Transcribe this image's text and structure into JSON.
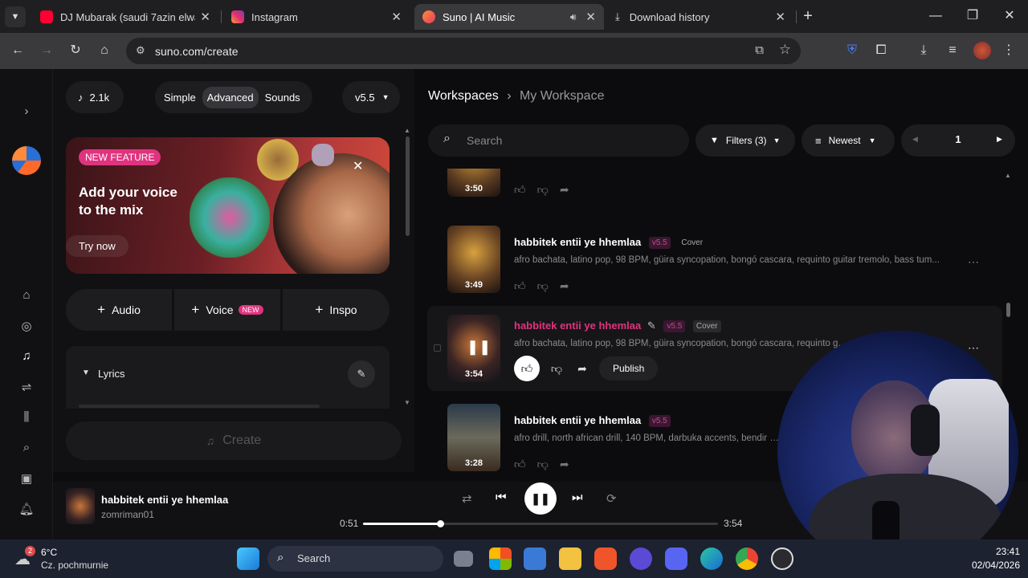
{
  "browser": {
    "tabs": [
      {
        "label": "DJ Mubarak (saudi 7azin elwat)",
        "color": "#ff0033",
        "active": false
      },
      {
        "label": "Instagram",
        "color": "#e1306c",
        "active": false
      },
      {
        "label": "Suno | AI Music",
        "color": "#ff6a3d",
        "active": true
      },
      {
        "label": "Download history",
        "color": "#cccccc",
        "active": false
      }
    ],
    "url": "suno.com/create"
  },
  "create": {
    "credits": "2.1k",
    "modes": [
      "Simple",
      "Advanced",
      "Sounds"
    ],
    "active_mode": "Advanced",
    "version": "v5.5",
    "banner": {
      "badge": "NEW FEATURE",
      "title_line1": "Add your voice",
      "title_line2": "to the mix",
      "cta": "Try now"
    },
    "tools": {
      "audio": "Audio",
      "voice": "Voice",
      "voice_badge": "NEW",
      "inspo": "Inspo"
    },
    "lyrics_label": "Lyrics",
    "create_button": "Create"
  },
  "workspace": {
    "breadcrumb_root": "Workspaces",
    "breadcrumb_current": "My Workspace",
    "search_placeholder": "Search",
    "filters_label": "Filters (3)",
    "sort_label": "Newest",
    "page": "1",
    "songs": [
      {
        "title": "",
        "tags": "",
        "duration": "3:50",
        "version": "",
        "type": ""
      },
      {
        "title": "habbitek entii ye hhemlaa",
        "tags": "afro bachata, latino pop, 98 BPM, güira syncopation, bongó cascara, requinto guitar tremolo, bass tum...",
        "duration": "3:49",
        "version": "v5.5",
        "type": "Cover"
      },
      {
        "title": "habbitek entii ye hhemlaa",
        "tags": "afro bachata, latino pop, 98 BPM, güira syncopation, bongó cascara, requinto guitar tr...",
        "duration": "3:54",
        "version": "v5.5",
        "type": "Cover",
        "publish": "Publish"
      },
      {
        "title": "habbitek entii ye hhemlaa",
        "tags": "afro drill, north african drill, 140 BPM, darbuka accents, bendir strik...",
        "duration": "3:28",
        "version": "v5.5",
        "type": ""
      }
    ]
  },
  "player": {
    "title": "habbitek entii ye hhemlaa",
    "artist": "zomriman01",
    "elapsed": "0:51",
    "total": "3:54",
    "progress": 0.2179
  },
  "taskbar": {
    "temperature": "6°C",
    "weather": "Cz. pochmurnie",
    "weather_badge": "2",
    "search": "Search",
    "time": "23:41",
    "date": "02/04/2026"
  },
  "colors": {
    "accent_pink": "#e0337f",
    "version_badge": "#c04a8e"
  }
}
